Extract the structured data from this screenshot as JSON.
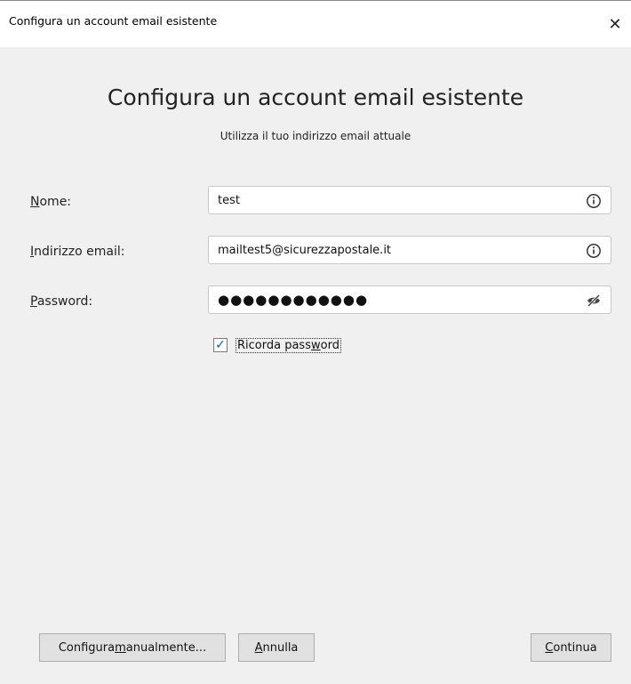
{
  "window": {
    "title": "Configura un account email esistente",
    "close_symbol": "✕"
  },
  "header": {
    "title": "Configura un account email esistente",
    "subtitle": "Utilizza il tuo indirizzo email attuale"
  },
  "form": {
    "name": {
      "label_accesskey": "N",
      "label_rest": "ome:",
      "value": "test",
      "icon": "info-icon"
    },
    "email": {
      "label_accesskey": "I",
      "label_rest": "ndirizzo email:",
      "value": "mailtest5@sicurezzapostale.it",
      "icon": "info-icon"
    },
    "password": {
      "label_accesskey": "P",
      "label_rest": "assword:",
      "value": "●●●●●●●●●●●●",
      "icon": "eye-slash-icon"
    },
    "remember": {
      "checked": true,
      "check_mark": "✓",
      "label_pre": "Ricorda pass",
      "label_accesskey": "w",
      "label_post": "ord"
    }
  },
  "buttons": {
    "manual": {
      "pre": "Configura ",
      "accesskey": "m",
      "post": "anualmente..."
    },
    "cancel": {
      "accesskey": "A",
      "post": "nnulla"
    },
    "continue": {
      "accesskey": "C",
      "post": "ontinua"
    }
  },
  "colors": {
    "accent": "#0060c0",
    "window_bg": "#f0f0f0",
    "button_bg": "#e1e1e1"
  }
}
